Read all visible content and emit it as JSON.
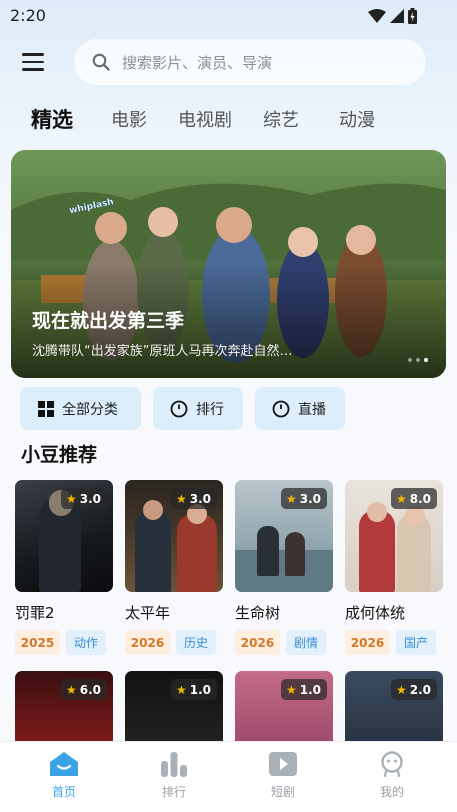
{
  "status_bar": {
    "time": "2:20"
  },
  "search": {
    "placeholder": "搜索影片、演员、导演"
  },
  "tabs": [
    {
      "label": "精选",
      "active": true
    },
    {
      "label": "电影"
    },
    {
      "label": "电视剧"
    },
    {
      "label": "综艺"
    },
    {
      "label": "动漫"
    }
  ],
  "banner": {
    "title": "现在就出发第三季",
    "subtitle": "沈腾带队“出发家族”原班人马再次奔赴自然…",
    "logo_text": "whiplash",
    "dot_count": 3,
    "active_dot": 2
  },
  "quick_actions": [
    {
      "label": "全部分类",
      "icon": "grid-icon"
    },
    {
      "label": "排行",
      "icon": "clock-icon"
    },
    {
      "label": "直播",
      "icon": "clock-icon"
    }
  ],
  "section": {
    "title": "小豆推荐"
  },
  "recommendations": [
    {
      "title": "罚罪2",
      "score": "3.0",
      "year": "2025",
      "genre": "动作"
    },
    {
      "title": "太平年",
      "score": "3.0",
      "year": "2026",
      "genre": "历史"
    },
    {
      "title": "生命树",
      "score": "3.0",
      "year": "2026",
      "genre": "剧情"
    },
    {
      "title": "成何体统",
      "score": "8.0",
      "year": "2026",
      "genre": "国产"
    },
    {
      "score": "6.0"
    },
    {
      "score": "1.0"
    },
    {
      "score": "1.0"
    },
    {
      "score": "2.0"
    }
  ],
  "bottom_nav": [
    {
      "label": "首页",
      "icon": "home-icon",
      "active": true
    },
    {
      "label": "排行",
      "icon": "bar-chart-icon"
    },
    {
      "label": "短剧",
      "icon": "play-icon"
    },
    {
      "label": "我的",
      "icon": "profile-icon"
    }
  ],
  "colors": {
    "accent": "#3aa3e8",
    "year_tag": "#d4792a",
    "genre_tag": "#3a8ed6",
    "star": "#f5b800"
  }
}
